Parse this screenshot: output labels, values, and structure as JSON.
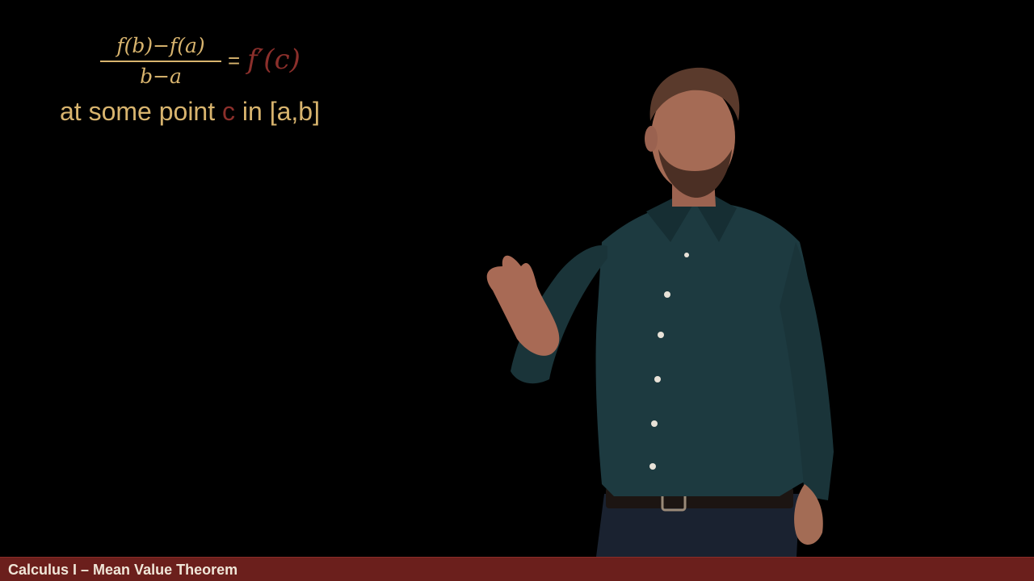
{
  "formula": {
    "numerator": "f(b)−f(a)",
    "denominator": "b−a",
    "equals": "=",
    "derivative": "f′(c)",
    "colors": {
      "text": "#d8b46e",
      "highlight": "#8b2f2b"
    }
  },
  "caption": {
    "prefix": "at some point ",
    "highlight": "c",
    "suffix": " in [a,b]"
  },
  "title_bar": {
    "text": "Calculus I – Mean Value Theorem",
    "background": "#6b1f1c"
  },
  "scene": {
    "background": "#000000",
    "subject": "presenter-figure"
  }
}
